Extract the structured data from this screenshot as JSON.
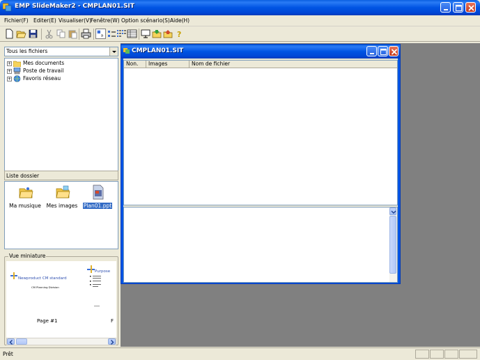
{
  "window": {
    "title": "EMP SlideMaker2 - CMPLAN01.SIT"
  },
  "menu": {
    "items": [
      {
        "label": "Fichier(F)"
      },
      {
        "label": "Editer(E)"
      },
      {
        "label": "Visualiser(V)"
      },
      {
        "label": "Fenêtre(W)"
      },
      {
        "label": "Option scénario(S)"
      },
      {
        "label": "Aide(H)"
      }
    ]
  },
  "toolbar": {
    "icons": [
      "new-icon",
      "open-icon",
      "save-icon",
      "cut-icon",
      "copy-icon",
      "paste-icon",
      "print-icon",
      "large-icons-icon",
      "small-icons-icon",
      "list-icon",
      "details-icon",
      "slideshow-icon",
      "export-icon",
      "import-icon",
      "help-icon"
    ]
  },
  "left_pane": {
    "filter": {
      "value": "Tous les fichiers"
    },
    "tree": [
      {
        "label": "Mes documents",
        "icon": "folder-icon"
      },
      {
        "label": "Poste de travail",
        "icon": "computer-icon"
      },
      {
        "label": "Favoris réseau",
        "icon": "network-icon"
      }
    ],
    "folder_list_title": "Liste dossier",
    "folder_items": [
      {
        "label": "Ma musique",
        "icon": "folder-music-icon"
      },
      {
        "label": "Mes images",
        "icon": "folder-pictures-icon"
      },
      {
        "label": "Plan01.ppt",
        "icon": "powerpoint-file-icon",
        "selected": true
      }
    ],
    "thumbnail": {
      "title": "Vue miniature",
      "slide_left_title": "Newproduct CM standard",
      "slide_left_subtitle": "CM Planning Division",
      "slide_right_title": "Purpose",
      "page_label": "Page #1",
      "next_page_label": "F"
    }
  },
  "child_window": {
    "title": "CMPLAN01.SIT",
    "columns": [
      {
        "label": "Non."
      },
      {
        "label": "Images"
      },
      {
        "label": "Nom de fichier"
      }
    ],
    "rows": []
  },
  "status": {
    "text": "Prêt"
  },
  "colors": {
    "titlebar": "#0054e3",
    "mdi_background": "#808080",
    "window_face": "#ece9d8",
    "selection": "#316ac5"
  }
}
